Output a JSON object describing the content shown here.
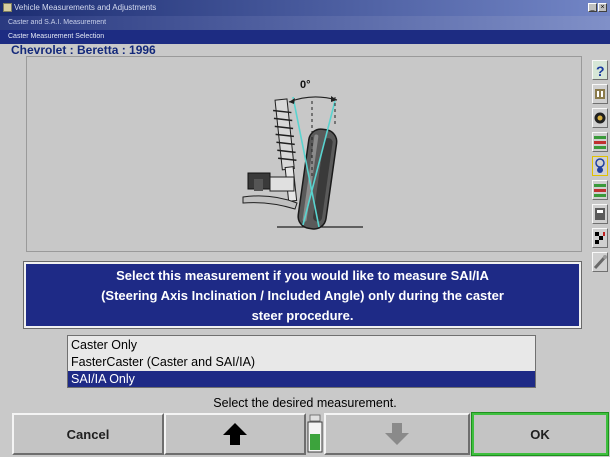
{
  "window": {
    "title": "Vehicle Measurements and Adjustments",
    "subtitle": "Caster and S.A.I. Measurement",
    "panel_title": "Caster Measurement Selection"
  },
  "vehicle": {
    "label": "Chevrolet : Beretta : 1996"
  },
  "diagram": {
    "angle_label": "0°"
  },
  "info": {
    "lines": [
      "Select this measurement if you would like to measure SAI/IA",
      "(Steering Axis Inclination / Included Angle) only during the caster",
      "steer procedure."
    ]
  },
  "options": {
    "items": [
      "Caster Only",
      "FasterCaster (Caster and SAI/IA)",
      "SAI/IA Only"
    ],
    "selected": "SAI/IA Only"
  },
  "prompt": "Select the desired measurement.",
  "buttons": {
    "cancel": "Cancel",
    "up": "up-arrow-icon",
    "down": "down-arrow-icon",
    "ok": "OK"
  },
  "colors": {
    "accent": "#1e2a86",
    "ok_border": "#3fbf3f"
  }
}
